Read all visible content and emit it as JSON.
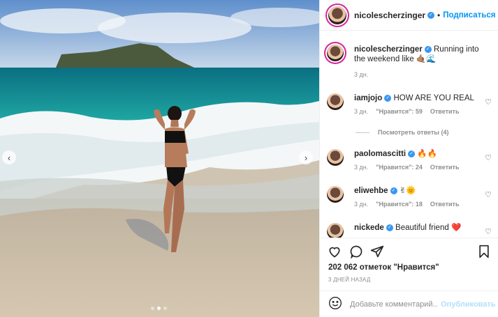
{
  "post": {
    "carousel_prev_icon": "chevron-left-icon",
    "carousel_next_icon": "chevron-right-icon",
    "carousel_total": 3,
    "carousel_active": 2
  },
  "header": {
    "username": "nicolescherzinger",
    "separator": "•",
    "follow_label": "Подписаться"
  },
  "caption": {
    "username": "nicolescherzinger",
    "text": "Running into the weekend like 🤙🏽🌊",
    "time": "3 дн."
  },
  "comments": [
    {
      "username": "iamjojo",
      "text": "HOW ARE YOU REAL",
      "time": "3 дн.",
      "likes": "\"Нравится\": 59",
      "reply": "Ответить"
    },
    {
      "username": "paolomascitti",
      "text": "🔥🔥",
      "time": "3 дн.",
      "likes": "\"Нравится\": 24",
      "reply": "Ответить"
    },
    {
      "username": "eliwehbe",
      "text": "✌🌞",
      "time": "3 дн.",
      "likes": "\"Нравится\": 18",
      "reply": "Ответить"
    },
    {
      "username": "nickede",
      "text": "Beautiful friend ❤️"
    }
  ],
  "view_replies": "Посмотреть ответы (4)",
  "actions": {
    "likes": "202 062 отметок \"Нравится\"",
    "date": "3 ДНЕЙ НАЗАД"
  },
  "add_comment": {
    "placeholder": "Добавьте комментарий...",
    "publish": "Опубликовать"
  },
  "colors": {
    "accent": "#0095f6",
    "verified": "#3897f0",
    "muted": "#8e8e8e",
    "publish_disabled": "#b2dffc"
  }
}
